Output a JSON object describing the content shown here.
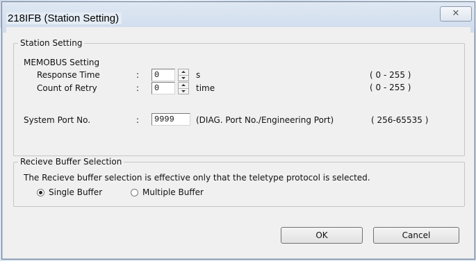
{
  "window": {
    "title": "218IFB (Station Setting)",
    "close_glyph": "✕"
  },
  "station_setting": {
    "legend": "Station Setting",
    "memobus_label": "MEMOBUS Setting",
    "response_time": {
      "label": "Response Time",
      "colon": ":",
      "value": "0",
      "unit": "s",
      "range": "( 0 - 255 )"
    },
    "count_of_retry": {
      "label": "Count of Retry",
      "colon": ":",
      "value": "0",
      "unit": "time",
      "range": "( 0 - 255 )"
    },
    "system_port": {
      "label": "System Port No.",
      "colon": ":",
      "value": "9999",
      "note": "(DIAG. Port No./Engineering Port)",
      "range": "( 256-65535 )"
    }
  },
  "receive_buffer": {
    "legend": "Recieve Buffer Selection",
    "description": "The Recieve buffer selection is effective only that the teletype protocol is selected.",
    "options": [
      {
        "label": "Single Buffer",
        "selected": true
      },
      {
        "label": "Multiple Buffer",
        "selected": false
      }
    ]
  },
  "buttons": {
    "ok": "OK",
    "cancel": "Cancel"
  }
}
